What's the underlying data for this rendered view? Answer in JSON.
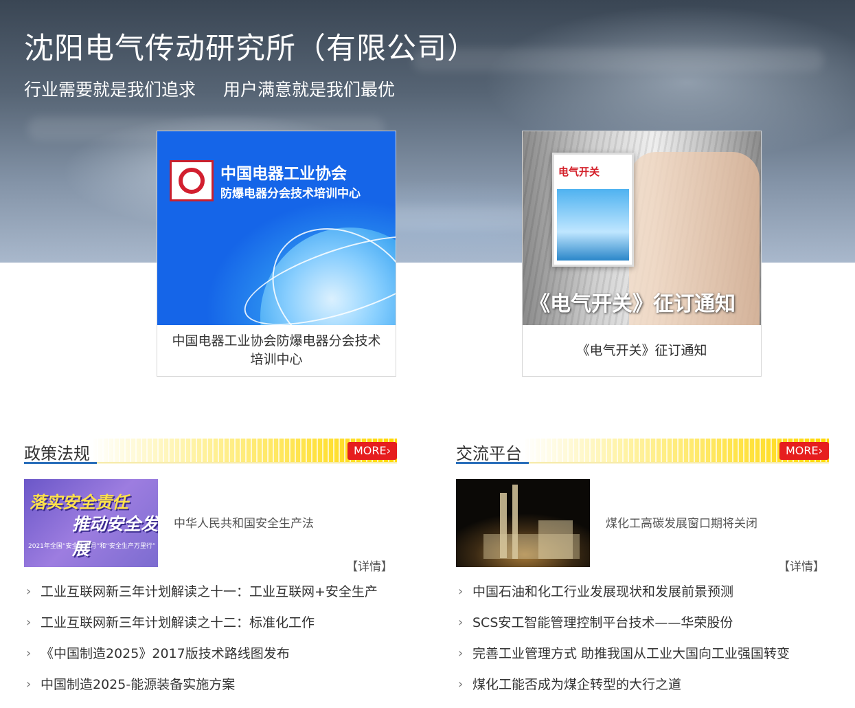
{
  "header": {
    "title": "沈阳电气传动研究所（有限公司）",
    "slogan_left": "行业需要就是我们追求",
    "slogan_right": "用户满意就是我们最优"
  },
  "cards": [
    {
      "caption": "中国电器工业协会防爆电器分会技术培训中心",
      "image_text_line1": "中国电器工业协会",
      "image_text_line2": "防爆电器分会技术培训中心"
    },
    {
      "caption": "《电气开关》征订通知",
      "image_magazine_title": "电气开关",
      "image_notice": "《电气开关》征订通知"
    }
  ],
  "sections": [
    {
      "title": "政策法规",
      "more_label": "MORE›",
      "feature": {
        "title": "中华人民共和国安全生产法",
        "detail_label": "【详情】",
        "thumb_text_1": "落实安全责任",
        "thumb_text_2": "推动安全发展",
        "thumb_text_3": "2021年全国“安全生产月”和“安全生产万里行”"
      },
      "items": [
        "工业互联网新三年计划解读之十一：工业互联网+安全生产",
        "工业互联网新三年计划解读之十二：标准化工作",
        "《中国制造2025》2017版技术路线图发布",
        "中国制造2025-能源装备实施方案"
      ]
    },
    {
      "title": "交流平台",
      "more_label": "MORE›",
      "feature": {
        "title": "煤化工高碳发展窗口期将关闭",
        "detail_label": "【详情】"
      },
      "items": [
        "中国石油和化工行业发展现状和发展前景预测",
        "SCS安工智能管理控制平台技术——华荣股份",
        "完善工业管理方式 助推我国从工业大国向工业强国转变",
        "煤化工能否成为煤企转型的大行之道"
      ]
    }
  ],
  "icons": {
    "list_bullet": "chevron-right-icon",
    "list_bullet_glyph": "›"
  },
  "colors": {
    "more_button": "#e61e1e",
    "section_underline": "#2b6fba",
    "section_band": "#ffd700"
  }
}
